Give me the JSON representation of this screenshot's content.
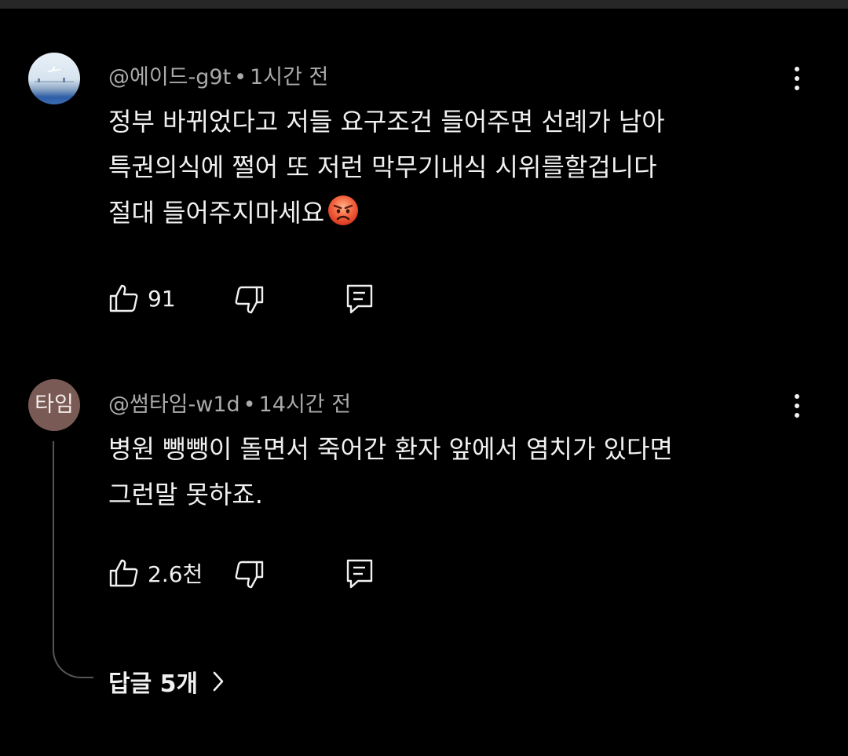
{
  "comments": [
    {
      "handle": "@에이드-g9t",
      "separator": "•",
      "time": "1시간 전",
      "lines": [
        "정부 바뀌었다고 저들 요구조건 들어주면 선례가 남아",
        "특권의식에 쩔어 또 저런 막무기내식 시위를할겁니다",
        "절대 들어주지마세요"
      ],
      "emoji": "angry-face-emoji",
      "likes": "91",
      "avatar": "airport-photo"
    },
    {
      "handle": "@썸타임-w1d",
      "separator": "•",
      "time": "14시간 전",
      "avatar_text": "타임",
      "lines": [
        "병원 뺑뺑이 돌면서 죽어간 환자 앞에서 염치가 있다면",
        "그런말 못하죠."
      ],
      "likes": "2.6천",
      "replies_label": "답글 5개"
    }
  ],
  "icons": {
    "like": "thumbs-up-icon",
    "dislike": "thumbs-down-icon",
    "reply": "reply-icon",
    "more": "more-vertical-icon",
    "expand": "chevron-right-icon"
  },
  "colors": {
    "background": "#000000",
    "text": "#f1f1f1",
    "meta": "#aaaaaa",
    "avatar2": "#7a5a54"
  }
}
